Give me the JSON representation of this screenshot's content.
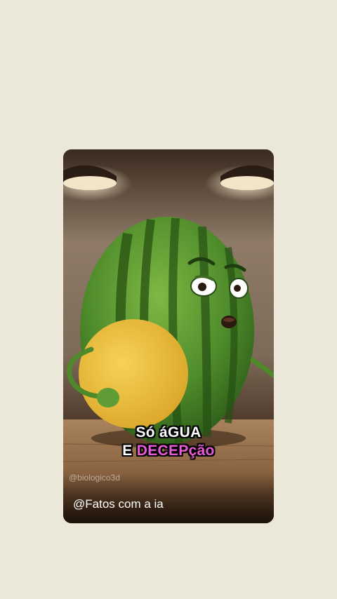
{
  "video": {
    "caption_line1": "Só áGUA",
    "caption_line2_prefix": "E",
    "caption_line2_highlight": "DECEPção",
    "watermark": "@biologico3d",
    "channel": "@Fatos com a ia"
  },
  "colors": {
    "page_background": "#ebe8da",
    "caption_text": "#ffffff",
    "caption_highlight": "#e85ad8"
  }
}
